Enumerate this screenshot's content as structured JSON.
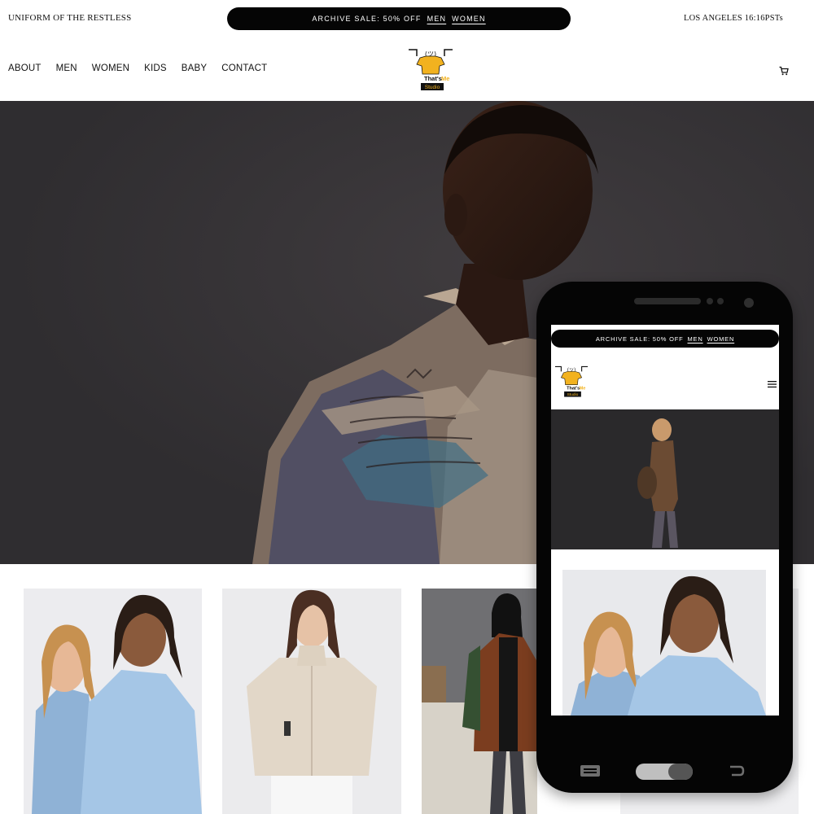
{
  "topbar": {
    "tagline": "UNIFORM OF THE RESTLESS",
    "promo_text": "ARCHIVE SALE: 50% OFF",
    "promo_men": "MEN",
    "promo_women": "WOMEN",
    "clock": "LOS ANGELES 16:16PSTs"
  },
  "nav": {
    "items": [
      "ABOUT",
      "MEN",
      "WOMEN",
      "KIDS",
      "BABY",
      "CONTACT"
    ]
  },
  "logo": {
    "line1": "That's Me",
    "line2": "Studio",
    "face": "¯\\_(ツ)_/¯"
  },
  "icons": {
    "cart": "cart-icon",
    "menu": "hamburger-menu-icon"
  },
  "mobile": {
    "promo_text": "ARCHIVE SALE: 50% OFF",
    "promo_men": "MEN",
    "promo_women": "WOMEN"
  },
  "colors": {
    "promo_bg": "#050505",
    "hero_bg": "#353336",
    "logo_yellow": "#f2b21f",
    "phone_body": "#050505"
  }
}
